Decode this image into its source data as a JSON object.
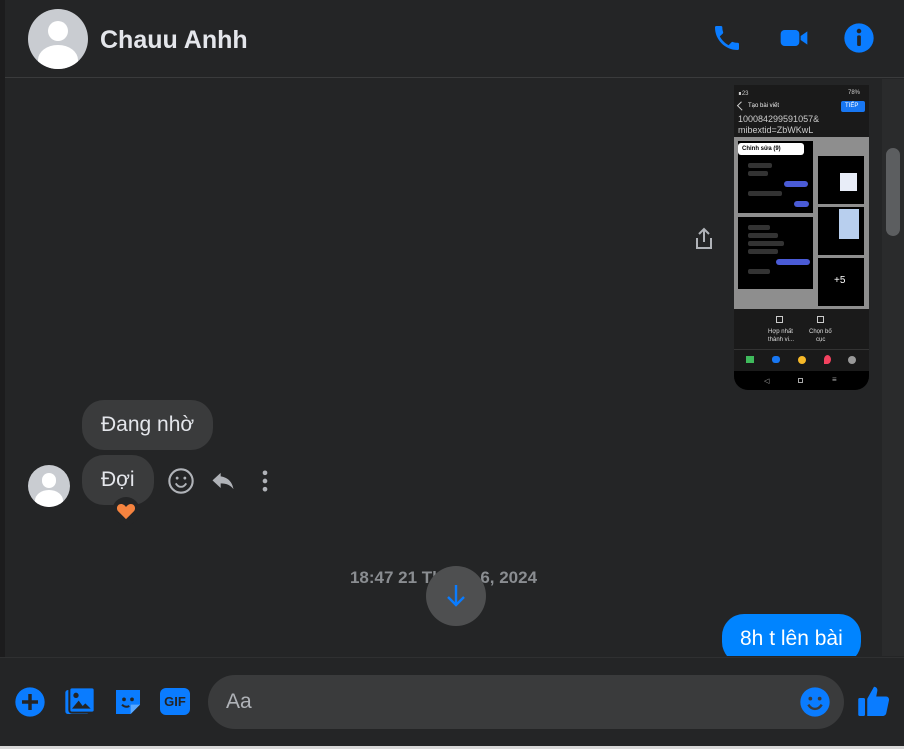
{
  "header": {
    "contact_name": "Chauu Anhh",
    "actions": [
      "phone-icon",
      "video-call-icon",
      "info-icon"
    ]
  },
  "colors": {
    "background": "#242526",
    "accent": "#0084ff",
    "incoming_bubble": "#3a3b3c",
    "reaction": "#f5833f"
  },
  "attachment": {
    "status_time": "∎23",
    "battery": "78%",
    "app_title": "Tạo bài viết",
    "next_button": "TIẾP",
    "link_line1": "100084299591057&",
    "link_line2": "mibextid=ZbWKwL",
    "edit_label": "Chỉnh sửa (9)",
    "more_count": "+5",
    "merge_label_1": "Hợp nhất",
    "merge_label_2": "thành vi...",
    "layout_label_1": "Chọn bố",
    "layout_label_2": "cục"
  },
  "messages": {
    "incoming_1": "Đang nhờ",
    "incoming_2": "Đợi",
    "incoming_2_reaction": "heart",
    "timestamp": "18:47 21 Th        6, 2024",
    "outgoing_1": "8h t lên bài"
  },
  "message_actions": [
    "react-icon",
    "reply-icon",
    "more-icon"
  ],
  "composer": {
    "placeholder": "Aa",
    "icons": [
      "plus-icon",
      "gallery-icon",
      "sticker-icon",
      "gif-icon",
      "emoji-icon",
      "like-icon"
    ],
    "gif_label": "GIF"
  }
}
